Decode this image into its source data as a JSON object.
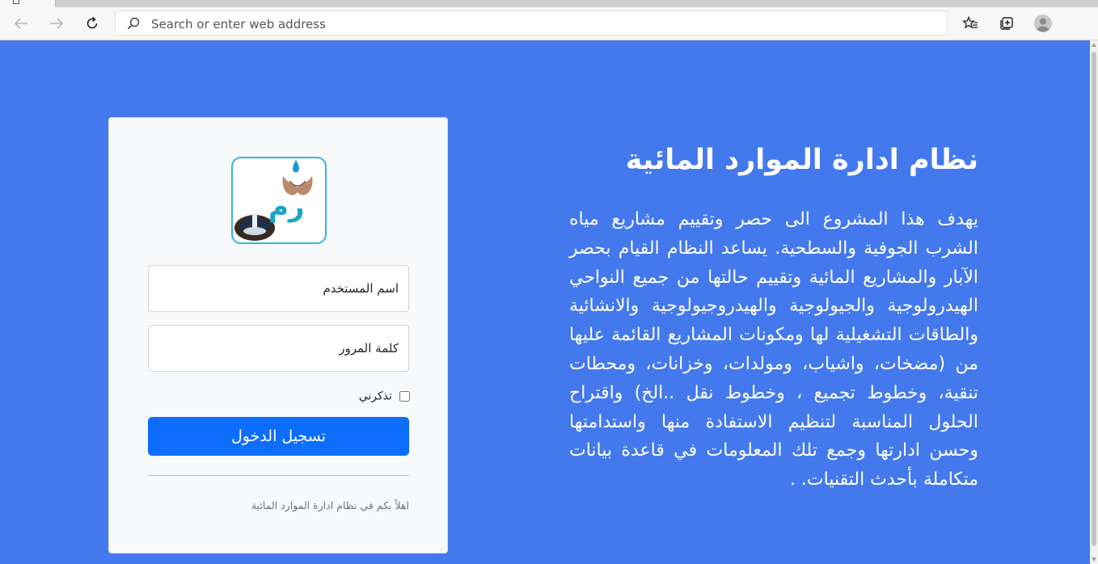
{
  "browser": {
    "address_placeholder": "Search or enter web address",
    "icons": [
      "back-arrow-icon",
      "forward-arrow-icon",
      "refresh-icon",
      "search-icon",
      "favorites-star-icon",
      "collections-icon",
      "profile-avatar-icon"
    ]
  },
  "colors": {
    "page_background": "#4379ec",
    "primary_button": "#0d6efd",
    "logo_border": "#35b3e2"
  },
  "hero": {
    "title": "نظام ادارة الموارد المائية",
    "description": "يهدف هذا المشروع الى حصر وتقييم مشاريع مياه الشرب الجوفية والسطحية. يساعد النظام القيام بحصر الآبار والمشاريع المائية وتقييم حالتها من جميع النواحي الهيدرولوجية والجيولوجية والهيدروجيولوجية والانشائية والطاقات التشغيلية لها ومكونات المشاريع القائمة عليها من (مضخات، واشياب، ومولدات، وخزانات، ومحطات تنقية، وخطوط تجميع ، وخطوط نقل ..الخ) واقتراح الحلول المناسبة لتنظيم الاستفادة منها واستدامتها وحسن ادارتها وجمع تلك المعلومات في قاعدة بيانات متكاملة بأحدث التقنيات. ."
  },
  "login": {
    "logo_text": "رم",
    "username_placeholder": "اسم المستخدم",
    "password_placeholder": "كلمة المرور",
    "remember_label": "تذكرني",
    "remember_checked": false,
    "submit_label": "تسجيل الدخول",
    "welcome_note": "اهلاً بكم في نظام ادارة الموارد المائية"
  }
}
